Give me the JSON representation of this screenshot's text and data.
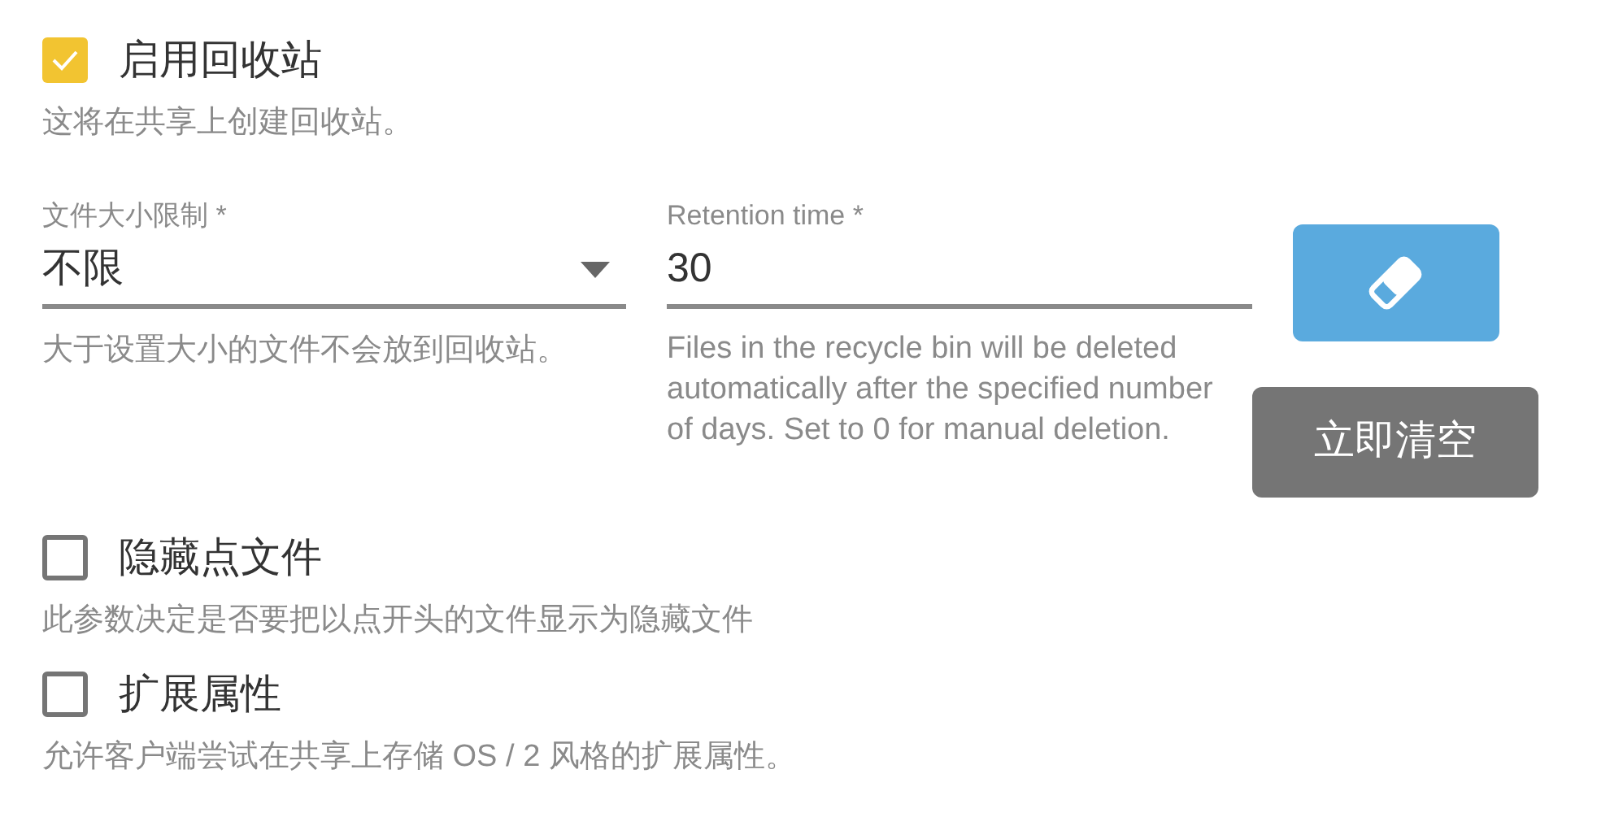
{
  "recycle_bin": {
    "label": "启用回收站",
    "checked": true,
    "description": "这将在共享上创建回收站。"
  },
  "file_size_limit": {
    "label": "文件大小限制 *",
    "value": "不限",
    "hint": "大于设置大小的文件不会放到回收站。"
  },
  "retention_time": {
    "label": "Retention time *",
    "value": "30",
    "hint": "Files in the recycle bin will be deleted automatically after the specified number of days. Set to 0 for manual deletion."
  },
  "clear_button": {
    "label": "立即清空"
  },
  "options": [
    {
      "label": "隐藏点文件",
      "checked": false,
      "description": "此参数决定是否要把以点开头的文件显示为隐藏文件"
    },
    {
      "label": "扩展属性",
      "checked": false,
      "description": "允许客户端尝试在共享上存储 OS / 2 风格的扩展属性。"
    }
  ]
}
